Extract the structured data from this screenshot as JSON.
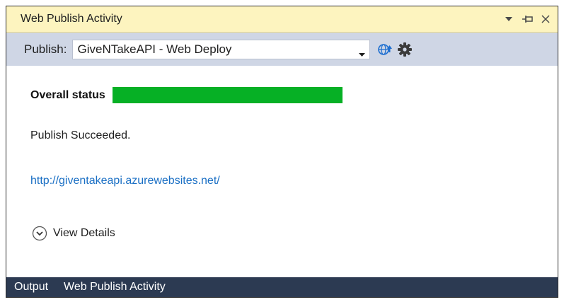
{
  "window": {
    "title": "Web Publish Activity"
  },
  "toolbar": {
    "publish_label": "Publish:",
    "profile": {
      "selected": "GiveNTakeAPI - Web Deploy"
    },
    "icons": [
      "globe-upload-icon",
      "gear-icon"
    ]
  },
  "main": {
    "overall_status_label": "Overall status",
    "overall_progress": 1.0,
    "message": "Publish Succeeded.",
    "site_url": "http://giventakeapi.azurewebsites.net/",
    "view_details_label": "View Details"
  },
  "tabs": [
    {
      "label": "Output"
    },
    {
      "label": "Web Publish Activity"
    }
  ],
  "colors": {
    "titlebar": "#fdf4bf",
    "toolbar": "#cfd6e5",
    "progress": "#06b025",
    "link": "#1a6fc4",
    "tabbar": "#2c3a52"
  }
}
